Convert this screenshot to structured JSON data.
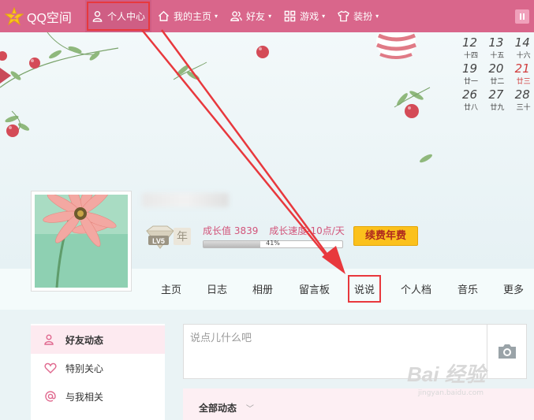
{
  "topbar": {
    "logo_text": "QQ空间",
    "nav": [
      {
        "label": "个人中心",
        "icon": "user-icon",
        "active": true
      },
      {
        "label": "我的主页",
        "icon": "home-icon",
        "dropdown": true
      },
      {
        "label": "好友",
        "icon": "friends-icon",
        "dropdown": true
      },
      {
        "label": "游戏",
        "icon": "grid-icon",
        "dropdown": true
      },
      {
        "label": "装扮",
        "icon": "shirt-icon",
        "dropdown": true
      }
    ],
    "caret": "▾"
  },
  "calendar": {
    "rows": [
      [
        {
          "d": "12",
          "l": "十四"
        },
        {
          "d": "13",
          "l": "十五"
        },
        {
          "d": "14",
          "l": "十六"
        }
      ],
      [
        {
          "d": "19",
          "l": "廿一"
        },
        {
          "d": "20",
          "l": "廿二"
        },
        {
          "d": "21",
          "l": "廿三",
          "red": true
        }
      ],
      [
        {
          "d": "26",
          "l": "廿八"
        },
        {
          "d": "27",
          "l": "廿九"
        },
        {
          "d": "28",
          "l": "三十"
        }
      ]
    ]
  },
  "profile": {
    "level_badge": "LV5",
    "level_suffix": "年",
    "growth_value": "成长值 3839",
    "growth_speed": "成长速度-10点/天",
    "progress_text": "41%",
    "progress": 0.41,
    "renew_label": "续费年费"
  },
  "tabs": [
    "主页",
    "日志",
    "相册",
    "留言板",
    "说说",
    "个人档",
    "音乐",
    "更多"
  ],
  "feed": {
    "sidebar": [
      {
        "label": "好友动态",
        "icon": "friends-outline-icon",
        "active": true
      },
      {
        "label": "特别关心",
        "icon": "heart-icon"
      },
      {
        "label": "与我相关",
        "icon": "at-icon"
      }
    ],
    "post_placeholder": "说点儿什么吧",
    "all_feeds_label": "全部动态"
  },
  "watermark": {
    "big": "Bai 经验",
    "small": "jingyan.baidu.com"
  },
  "colors": {
    "topbar": "#d9668b",
    "highlight": "#e8383d",
    "renew": "#fbc11c"
  }
}
